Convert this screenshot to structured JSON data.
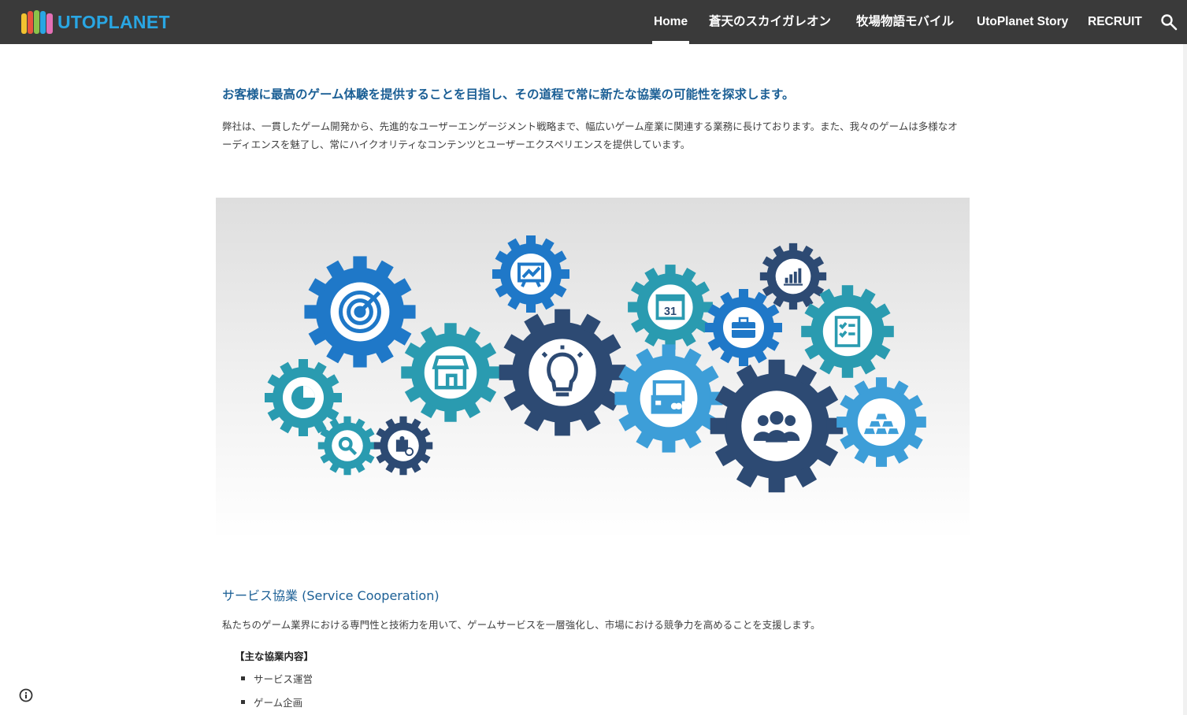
{
  "header": {
    "logo_text": "UTOPLANET",
    "nav": [
      {
        "label": "Home",
        "active": true
      },
      {
        "label": "蒼天のスカイガレオン",
        "active": false
      },
      {
        "label": "牧場物語モバイル",
        "active": false
      },
      {
        "label": "UtoPlanet Story",
        "active": false
      },
      {
        "label": "RECRUIT",
        "active": false
      }
    ],
    "search_icon": "search-icon"
  },
  "intro": {
    "heading": "お客様に最高のゲーム体験を提供することを目指し、その道程で常に新たな協業の可能性を探求します。",
    "paragraph": "弊社は、一貫したゲーム開発から、先進的なユーザーエンゲージメント戦略まで、幅広いゲーム産業に関連する業務に長けております。また、我々のゲームは多様なオーディエンスを魅了し、常にハイクオリティなコンテンツとユーザーエクスペリエンスを提供しています。"
  },
  "hero_image": {
    "icons": [
      "target-icon",
      "presentation-icon",
      "store-icon",
      "lightbulb-icon",
      "pie-chart-icon",
      "magnifier-icon",
      "puzzle-icon",
      "calendar-icon",
      "briefcase-icon",
      "bar-chart-icon",
      "checklist-icon",
      "credit-card-icon",
      "team-icon",
      "gold-bars-icon"
    ],
    "calendar_day": "31",
    "colors": {
      "dark": "#2d4a73",
      "blue": "#1f78c8",
      "teal": "#2a9bb0",
      "light": "#3d9ed8"
    }
  },
  "service": {
    "heading": "サービス協業 (Service Cooperation)",
    "paragraph": "私たちのゲーム業界における専門性と技術力を用いて、ゲームサービスを一層強化し、市場における競争力を高めることを支援します。",
    "list_title": "【主な協業内容】",
    "items": [
      "サービス運営",
      "ゲーム企画"
    ]
  },
  "colors": {
    "header_bg": "#3a3a3a",
    "heading": "#1b5f95",
    "logo": "#29a6e3",
    "text": "#404040"
  }
}
